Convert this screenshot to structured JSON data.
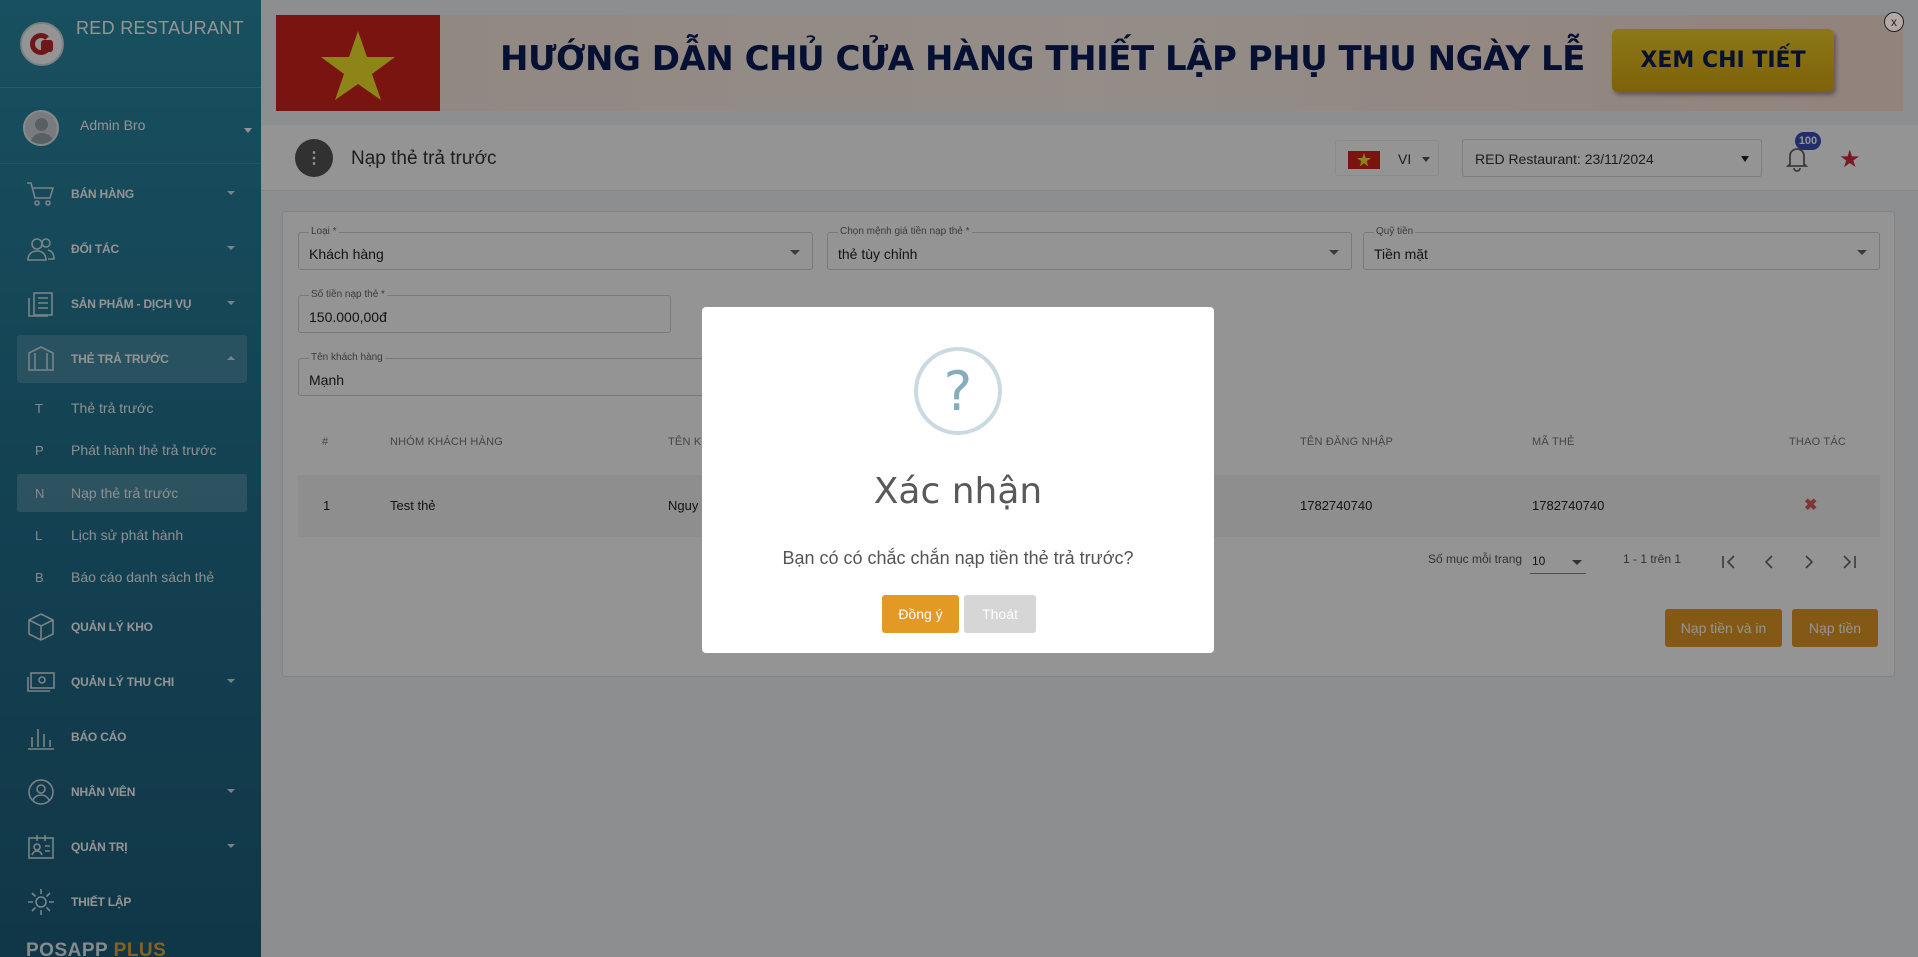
{
  "sidebar": {
    "brand": "RED RESTAURANT",
    "user": "Admin Bro",
    "menu": [
      {
        "label": "BÁN HÀNG",
        "icon": "cart-icon"
      },
      {
        "label": "ĐỐI TÁC",
        "icon": "partners-icon"
      },
      {
        "label": "SẢN PHẨM - DỊCH VỤ",
        "icon": "products-icon"
      },
      {
        "label": "THẺ TRẢ TRƯỚC",
        "icon": "prepaid-card-icon"
      },
      {
        "label": "QUẢN LÝ KHO",
        "icon": "box-icon"
      },
      {
        "label": "QUẢN LÝ THU CHI",
        "icon": "money-icon"
      },
      {
        "label": "BÁO CÁO",
        "icon": "chart-icon"
      },
      {
        "label": "NHÂN VIÊN",
        "icon": "staff-icon"
      },
      {
        "label": "QUẢN TRỊ",
        "icon": "admin-icon"
      },
      {
        "label": "THIẾT LẬP",
        "icon": "gear-icon"
      }
    ],
    "submenu": [
      {
        "letter": "T",
        "label": "Thẻ trả trước"
      },
      {
        "letter": "P",
        "label": "Phát hành thẻ trả trước"
      },
      {
        "letter": "N",
        "label": "Nạp thẻ trả trước"
      },
      {
        "letter": "L",
        "label": "Lịch sử phát hành"
      },
      {
        "letter": "B",
        "label": "Báo cáo danh sách thẻ"
      }
    ],
    "footer_main": "POSAPP",
    "footer_plus": "PLUS"
  },
  "banner": {
    "text": "HƯỚNG DẪN CHỦ CỬA HÀNG THIẾT LẬP PHỤ THU NGÀY LỄ",
    "button": "XEM CHI TIẾT"
  },
  "close_label": "x",
  "header": {
    "title": "Nạp thẻ trả trước",
    "menu_glyph": "⋮",
    "lang": "VI",
    "store": "RED Restaurant: 23/11/2024",
    "notification_count": "100",
    "star_glyph": "★"
  },
  "form": {
    "type": {
      "label": "Loại *",
      "value": "Khách hàng"
    },
    "denomination": {
      "label": "Chọn mệnh giá tiền nạp thẻ *",
      "value": "thẻ tùy chỉnh"
    },
    "fund": {
      "label": "Quỹ tiền",
      "value": "Tiền mặt"
    },
    "amount": {
      "label": "Số tiền nạp thẻ *",
      "value": "150.000,00đ"
    },
    "customer": {
      "label": "Tên khách hàng",
      "value": "Mạnh"
    }
  },
  "table": {
    "headers": [
      "#",
      "NHÓM KHÁCH HÀNG",
      "TÊN K",
      "TÊN ĐĂNG NHẬP",
      "MÃ THẺ",
      "THAO TÁC"
    ],
    "rows": [
      {
        "index": "1",
        "group": "Test thẻ",
        "name": "Nguy",
        "username": "1782740740",
        "card": "1782740740",
        "action": "✖"
      }
    ]
  },
  "pagination": {
    "per_page_label": "Số mục mỗi trang",
    "per_page": "10",
    "range": "1 - 1 trên 1"
  },
  "actions": {
    "topup_print": "Nạp tiền và in",
    "topup": "Nạp tiền"
  },
  "modal": {
    "icon_glyph": "?",
    "title": "Xác nhận",
    "message": "Bạn có có chắc chắn nạp tiền thẻ trả trước?",
    "ok": "Đồng ý",
    "cancel": "Thoát"
  },
  "colors": {
    "sidebar": "#22728f",
    "accent": "#e39a25",
    "banner_text": "#0b1d56"
  }
}
